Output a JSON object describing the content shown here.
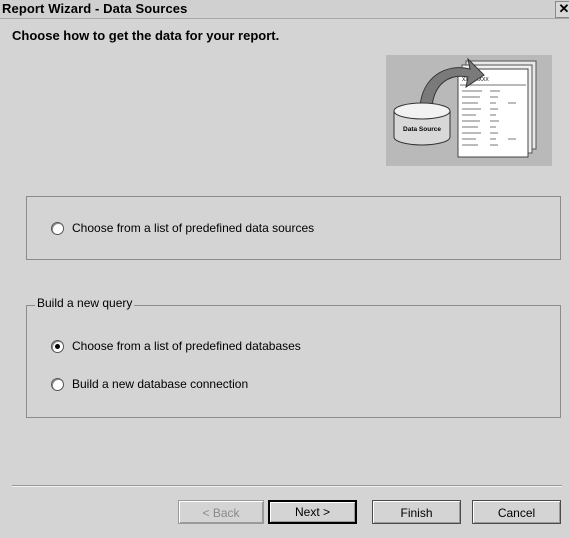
{
  "window": {
    "title": "Report Wizard - Data Sources",
    "close_label": "✕"
  },
  "heading": "Choose how to get the data for your report.",
  "illustration": {
    "data_source_label": "Data Source",
    "report_header": "XXXXXXXX"
  },
  "options": {
    "predefined_sources": "Choose from a list of predefined data sources",
    "build_query_legend": "Build a new query",
    "predefined_databases": "Choose from a list of predefined databases",
    "new_connection": "Build a new database connection",
    "selected": "predefined_databases"
  },
  "buttons": {
    "back": "< Back",
    "next": "Next >",
    "finish": "Finish",
    "cancel": "Cancel"
  }
}
